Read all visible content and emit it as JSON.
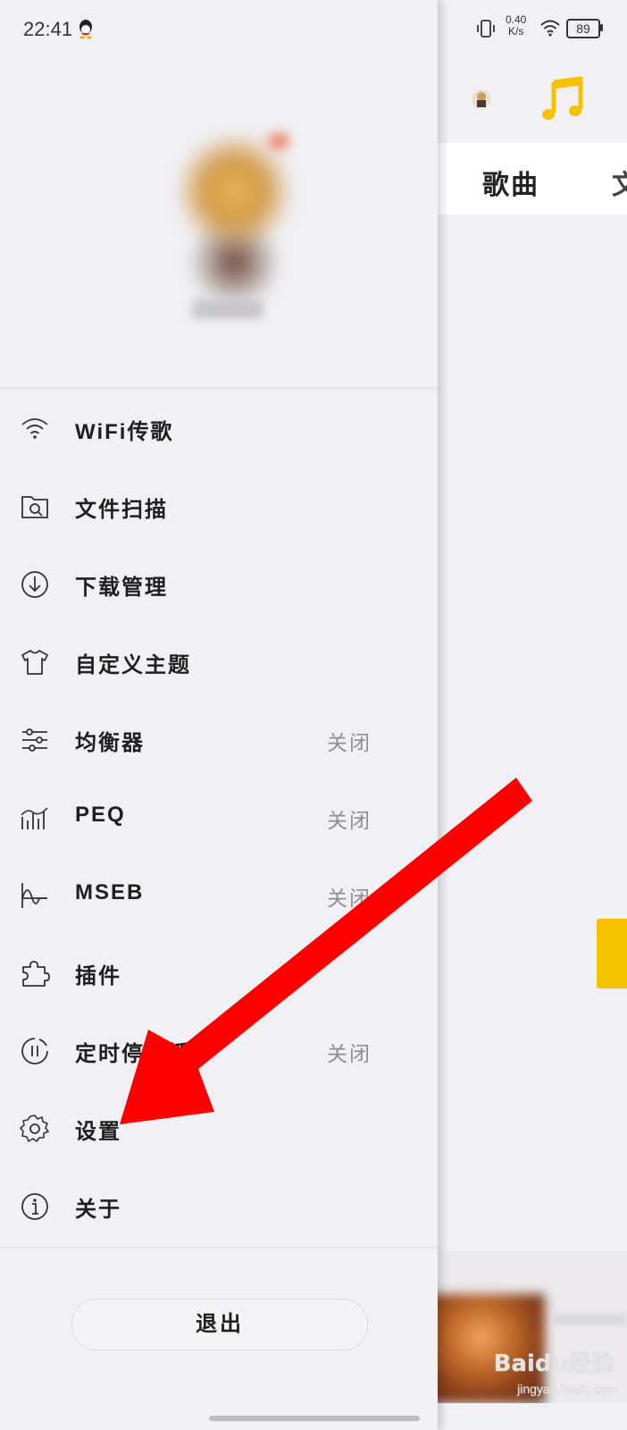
{
  "status_bar": {
    "time": "22:41",
    "net_speed": "0.40",
    "net_unit": "K/s",
    "battery": "89"
  },
  "drawer": {
    "menu": [
      {
        "label": "WiFi传歌",
        "icon": "wifi-icon",
        "status": ""
      },
      {
        "label": "文件扫描",
        "icon": "file-scan-icon",
        "status": ""
      },
      {
        "label": "下载管理",
        "icon": "download-icon",
        "status": ""
      },
      {
        "label": "自定义主题",
        "icon": "tshirt-icon",
        "status": ""
      },
      {
        "label": "均衡器",
        "icon": "equalizer-icon",
        "status": "关闭"
      },
      {
        "label": "PEQ",
        "icon": "peq-icon",
        "status": "关闭"
      },
      {
        "label": "MSEB",
        "icon": "mseb-icon",
        "status": "关闭"
      },
      {
        "label": "插件",
        "icon": "plugin-icon",
        "status": ""
      },
      {
        "label": "定时停止播",
        "icon": "timer-icon",
        "status": "关闭"
      },
      {
        "label": "设置",
        "icon": "gear-icon",
        "status": ""
      },
      {
        "label": "关于",
        "icon": "info-icon",
        "status": ""
      }
    ],
    "logout_label": "退出"
  },
  "main": {
    "tabs": [
      {
        "label": "歌曲"
      },
      {
        "label": "文"
      }
    ],
    "accent_color": "#f6c200"
  },
  "watermark": {
    "brand": "Baidu经验",
    "url": "jingyan.baidu.com"
  },
  "annotation": {
    "arrow_color": "#ff0000",
    "target": "settings"
  }
}
